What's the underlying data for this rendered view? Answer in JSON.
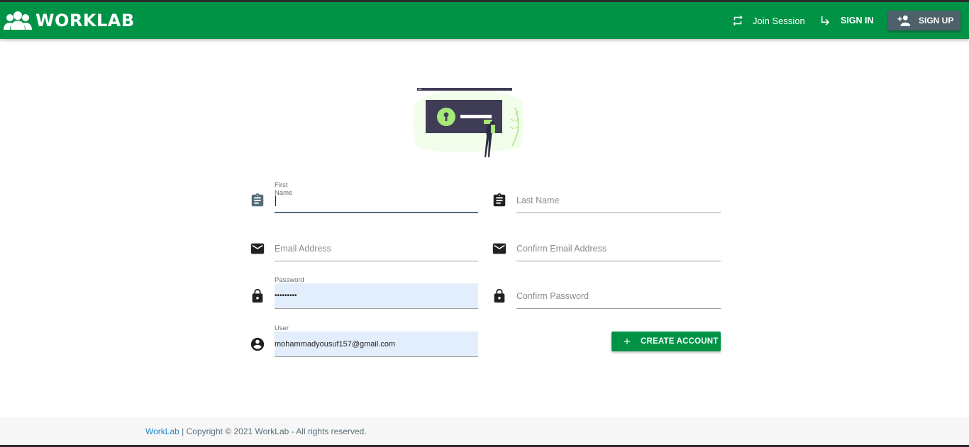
{
  "navbar": {
    "brand": "WORKLAB",
    "join_session": "Join Session",
    "sign_in": "SIGN IN",
    "sign_up": "SIGN UP",
    "color": "#009345"
  },
  "form": {
    "first_name": {
      "label": "First Name",
      "value": ""
    },
    "last_name": {
      "placeholder": "Last Name"
    },
    "email": {
      "placeholder": "Email Address"
    },
    "confirm_email": {
      "placeholder": "Confirm Email Address"
    },
    "password": {
      "label": "Password",
      "value": "•••••••••"
    },
    "confirm_password": {
      "placeholder": "Confirm Password"
    },
    "user_name": {
      "label": "User Name",
      "value": "mohammadyousuf157@gmail.com"
    },
    "create_account": "CREATE ACCOUNT"
  },
  "footer": {
    "link": "WorkLab",
    "text": " | Copyright © 2021 WorkLab - All rights reserved."
  },
  "icons": {
    "brand": "group-icon",
    "join": "swap-arrows-icon",
    "signin": "subdirectory-arrow-icon",
    "signup": "person-add-icon",
    "name": "clipboard-icon",
    "email": "envelope-icon",
    "password": "lock-icon",
    "user": "account-circle-icon",
    "create": "plus-icon"
  }
}
